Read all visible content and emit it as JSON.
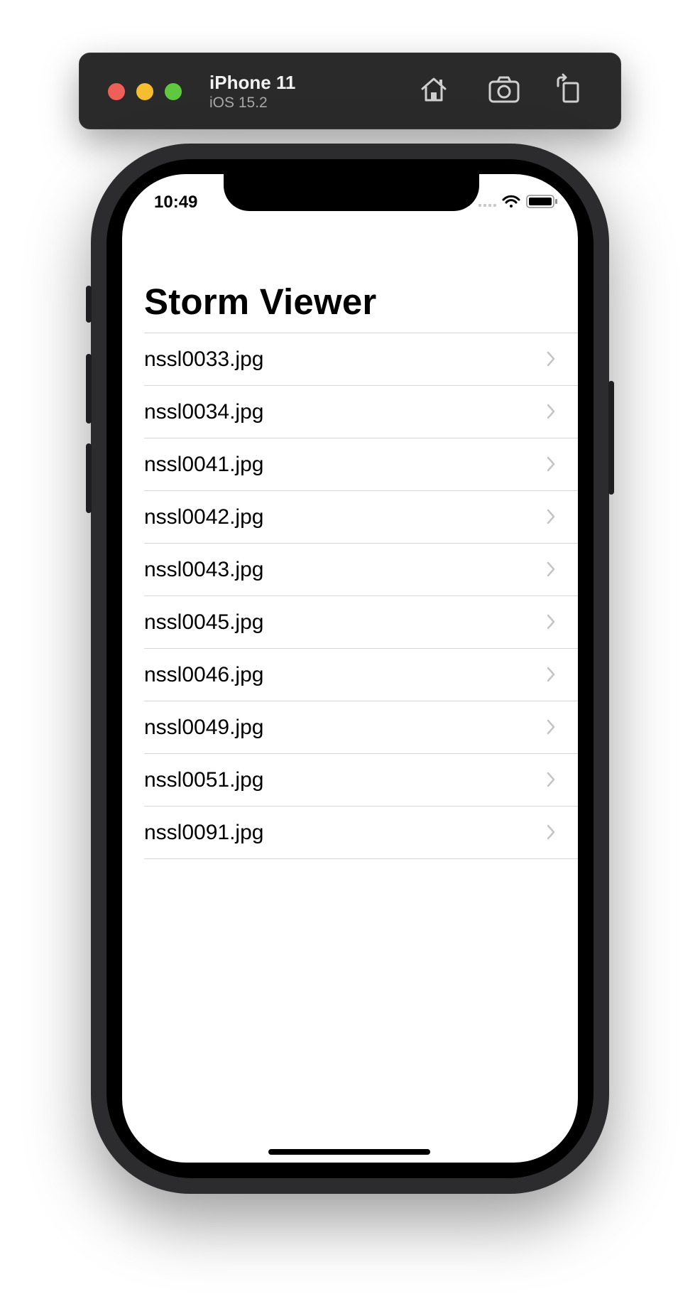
{
  "simulator": {
    "device_name": "iPhone 11",
    "os_version": "iOS 15.2",
    "icons": [
      "home-icon",
      "screenshot-icon",
      "rotate-icon"
    ]
  },
  "status_bar": {
    "time": "10:49",
    "icons": [
      "cellular-icon",
      "wifi-icon",
      "battery-icon"
    ]
  },
  "nav": {
    "title": "Storm Viewer"
  },
  "list": {
    "items": [
      {
        "label": "nssl0033.jpg"
      },
      {
        "label": "nssl0034.jpg"
      },
      {
        "label": "nssl0041.jpg"
      },
      {
        "label": "nssl0042.jpg"
      },
      {
        "label": "nssl0043.jpg"
      },
      {
        "label": "nssl0045.jpg"
      },
      {
        "label": "nssl0046.jpg"
      },
      {
        "label": "nssl0049.jpg"
      },
      {
        "label": "nssl0051.jpg"
      },
      {
        "label": "nssl0091.jpg"
      }
    ]
  }
}
